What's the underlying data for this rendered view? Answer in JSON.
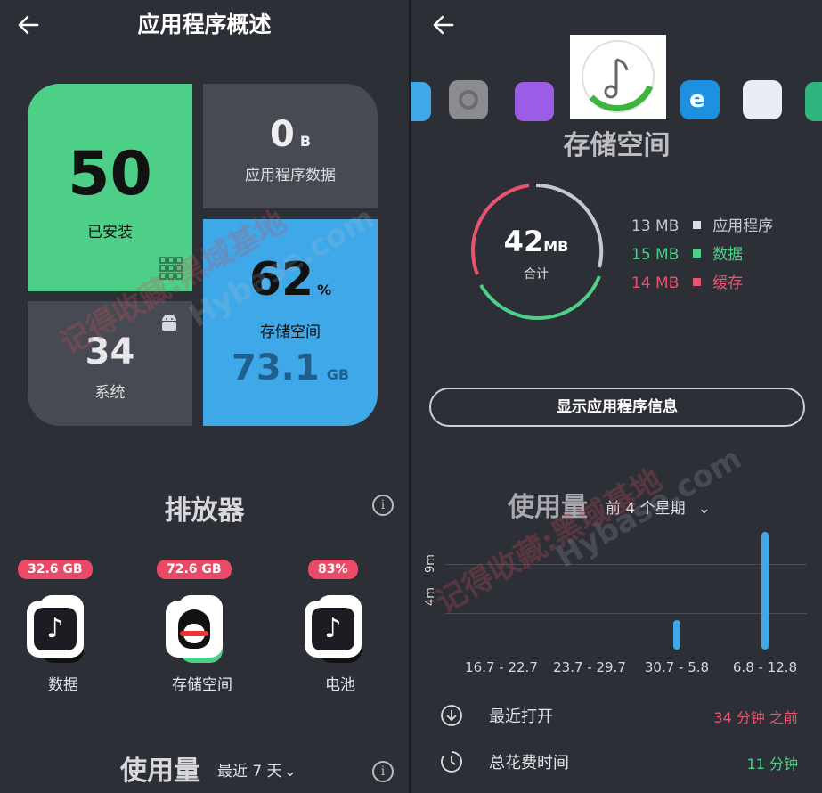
{
  "left": {
    "title": "应用程序概述",
    "tiles": {
      "installed": {
        "value": "50",
        "label": "已安装"
      },
      "app_data": {
        "value": "0",
        "unit": "B",
        "label": "应用程序数据"
      },
      "system": {
        "value": "34",
        "label": "系统"
      },
      "storage": {
        "percent": "62",
        "percent_unit": "%",
        "label": "存储空间",
        "size": "73.1",
        "size_unit": "GB"
      }
    },
    "emissions": {
      "title": "排放器",
      "items": [
        {
          "badge": "32.6 GB",
          "label": "数据"
        },
        {
          "badge": "72.6 GB",
          "label": "存储空间"
        },
        {
          "badge": "83%",
          "label": "电池"
        }
      ]
    },
    "usage": {
      "title": "使用量",
      "range": "最近 7 天"
    }
  },
  "right": {
    "section_title": "存储空间",
    "donut": {
      "total": "42",
      "unit": "MB",
      "caption": "合计"
    },
    "legend": [
      {
        "amount": "13 MB",
        "label": "应用程序",
        "color": "#c8c8cc"
      },
      {
        "amount": "15 MB",
        "label": "数据",
        "color": "#4ecf87"
      },
      {
        "amount": "14 MB",
        "label": "缓存",
        "color": "#e8546e"
      }
    ],
    "show_button": "显示应用程序信息",
    "usage": {
      "title": "使用量",
      "range": "前 4 个星期"
    },
    "chart_data": {
      "type": "bar",
      "categories": [
        "16.7 - 22.7",
        "23.7 - 29.7",
        "30.7 - 5.8",
        "6.8 - 12.8"
      ],
      "values": [
        0,
        0,
        3,
        12
      ],
      "y_ticks": [
        "4m",
        "9m"
      ],
      "bar_color": "#3ea8e8"
    },
    "stats": [
      {
        "label": "最近打开",
        "value": "34 分钟 之前",
        "color": "#e8546e"
      },
      {
        "label": "总花费时间",
        "value": "11 分钟",
        "color": "#4ecf87"
      }
    ]
  },
  "watermark": {
    "left": "记得收藏:黑域基地",
    "right": "记得收藏:黑域基地",
    "url": "Hybase.com"
  }
}
